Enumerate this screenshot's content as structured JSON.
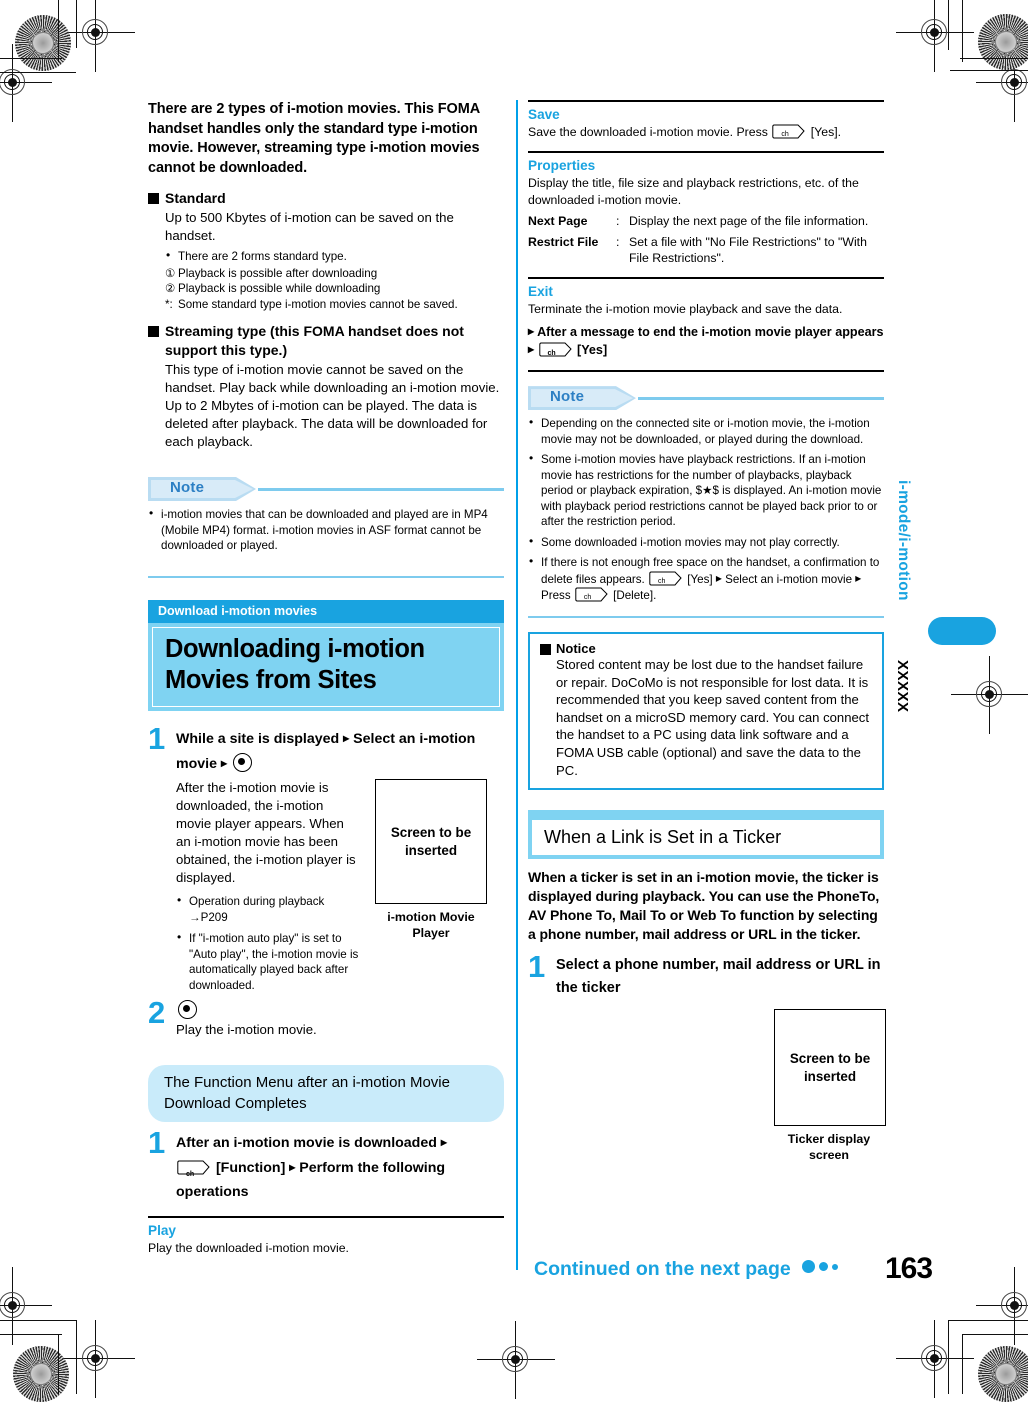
{
  "document": {
    "page_number": "163",
    "continued_label": "Continued on the next page",
    "margin_tab_vertical_label": "i-mode/i-motion",
    "margin_placeholder": "XXXXX"
  },
  "left_column": {
    "lead_paragraph": "There are 2 types of i-motion movies. This FOMA handset handles only the standard type i-motion movie. However, streaming type i-motion movies cannot be downloaded.",
    "standard": {
      "heading": "Standard",
      "body": "Up to 500 Kbytes of i-motion can be saved on the handset.",
      "bullet": "There are 2 forms standard type.",
      "item1_num": "①",
      "item1": "Playback is possible after downloading",
      "item2_num": "②",
      "item2": "Playback is possible while downloading",
      "footnote_mark": "*:",
      "footnote": "Some standard type i-motion movies cannot be saved."
    },
    "streaming": {
      "heading": "Streaming type (this FOMA handset does not support this type.)",
      "body": "This type of i-motion movie cannot be saved on the handset. Play back while downloading an i-motion movie. Up to 2 Mbytes of i-motion can be played. The data is deleted after playback. The data will be downloaded for each playback."
    },
    "note": {
      "label": "Note",
      "items": [
        "i-motion movies that can be downloaded and played are in MP4 (Mobile MP4) format. i-motion movies in ASF format cannot be downloaded or played."
      ]
    },
    "banner": {
      "eyebrow": "Download i-motion movies",
      "title": "Downloading i-motion Movies from Sites"
    },
    "step1": {
      "number": "1",
      "title_part1": "While a site is displayed",
      "title_part2": "Select an i-motion movie",
      "body": "After the i-motion movie is downloaded, the i-motion movie player appears. When an i-motion movie has been obtained, the i-motion player is displayed.",
      "bullets": [
        "Operation during playback →P209",
        "If \"i-motion auto play\" is set to \"Auto play\", the i-motion movie is automatically played back after downloaded."
      ],
      "screen_placeholder": "Screen to be inserted",
      "screen_caption": "i-motion Movie Player"
    },
    "step2": {
      "number": "2",
      "body": "Play the i-motion movie."
    },
    "function_menu": {
      "pill_title": "The Function Menu after an i-motion Movie Download Completes",
      "step": {
        "number": "1",
        "title_part1": "After an i-motion movie is downloaded",
        "title_part2": "[Function]",
        "title_part3": "Perform the following operations"
      },
      "entries": [
        {
          "name": "Play",
          "desc": "Play the downloaded i-motion movie."
        }
      ]
    }
  },
  "right_column": {
    "entries": [
      {
        "name": "Save",
        "desc_before": "Save the downloaded i-motion movie. Press",
        "desc_after": "[Yes]."
      }
    ],
    "properties": {
      "name": "Properties",
      "desc": "Display the title, file size and playback restrictions, etc. of the downloaded i-motion movie.",
      "rows": [
        {
          "key": "Next Page",
          "colon": ":",
          "value": "Display the next page of the file information."
        },
        {
          "key": "Restrict File",
          "colon": ":",
          "value": "Set a file with \"No File Restrictions\" to \"With File Restrictions\"."
        }
      ]
    },
    "exit": {
      "name": "Exit",
      "desc": "Terminate the i-motion movie playback and save the data.",
      "sub_part1": "After a message to end the i-motion movie player appears",
      "sub_part2": "[Yes]"
    },
    "note": {
      "label": "Note",
      "items": [
        "Depending on the connected site or i-motion movie, the i-motion movie may not be downloaded, or played during the download.",
        "Some i-motion movies have playback restrictions. If an i-motion movie has restrictions for the number of playbacks, playback period or playback expiration, $★$ is displayed. An i-motion movie with playback period restrictions cannot be played back prior to or after the restriction period.",
        "Some downloaded i-motion movies may not play correctly."
      ],
      "last_item_part1": "If there is not enough free space on the handset, a confirmation to delete files appears.",
      "last_item_part2": "[Yes]",
      "last_item_part3": "Select an i-motion movie",
      "last_item_part4": "Press",
      "last_item_part5": "[Delete]."
    },
    "notice": {
      "heading": "Notice",
      "body": "Stored content may be lost due to the handset failure or repair. DoCoMo is not responsible for lost data. It is recommended that you keep saved content from the handset on a microSD memory card. You can connect the handset to a PC using data link software and a FOMA USB cable (optional) and save the data to the PC."
    },
    "ticker_section": {
      "title": "When a Link is Set in a Ticker",
      "lead": "When a ticker is set in an i-motion movie, the ticker is displayed during playback. You can use the PhoneTo, AV Phone To, Mail To or Web To function by selecting a phone number, mail address or URL in the ticker.",
      "step": {
        "number": "1",
        "title": "Select a phone number, mail address or URL in the ticker"
      },
      "screen_placeholder": "Screen to be inserted",
      "screen_caption": "Ticker display screen"
    }
  },
  "glyphs": {
    "arrow": "▸",
    "ch_key_label": "ch"
  },
  "colors": {
    "accent": "#19a3e0",
    "light_cyan": "#7fd3f2",
    "pale_cyan": "#c9ebfa",
    "note_tab": "#b9dcf2",
    "note_text": "#2c7fc4"
  }
}
